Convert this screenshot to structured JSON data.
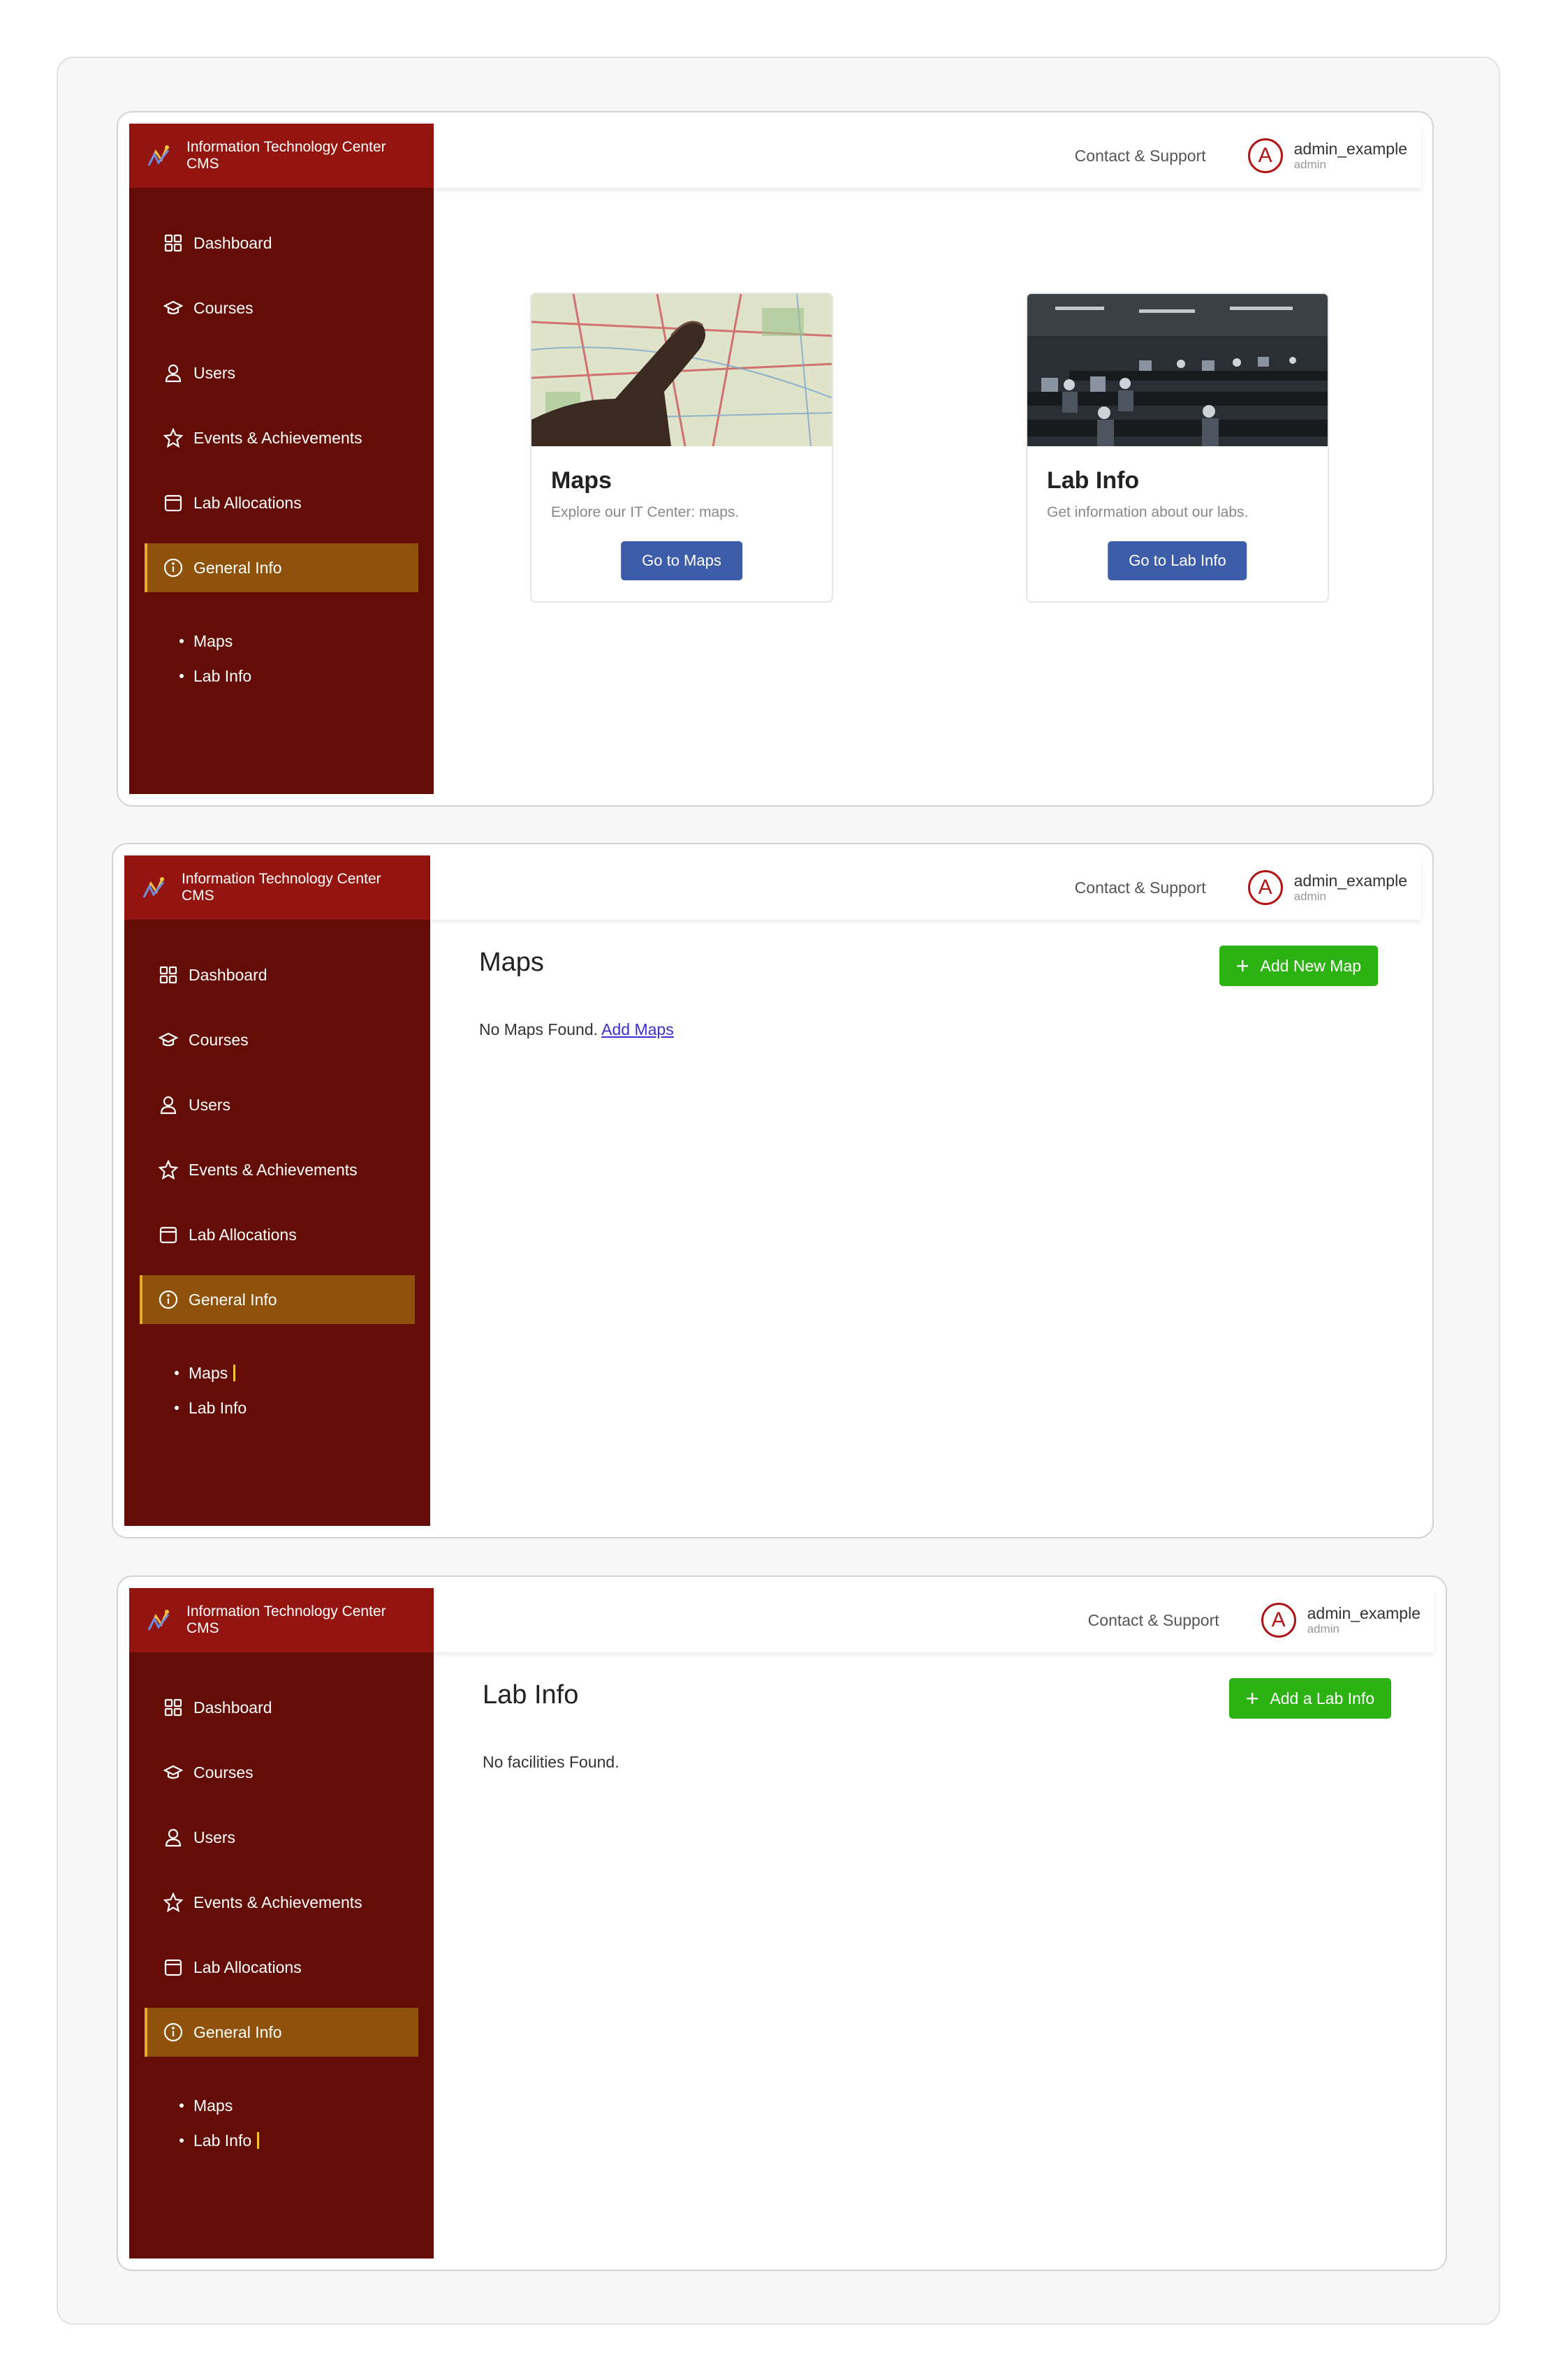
{
  "brand": {
    "line1": "Information Technology Center",
    "line2": "CMS"
  },
  "menu": [
    {
      "label": "Dashboard",
      "icon": "dashboard-icon"
    },
    {
      "label": "Courses",
      "icon": "graduation-cap-icon"
    },
    {
      "label": "Users",
      "icon": "user-icon"
    },
    {
      "label": "Events & Achievements",
      "icon": "star-icon"
    },
    {
      "label": "Lab Allocations",
      "icon": "calendar-icon"
    },
    {
      "label": "General Info",
      "icon": "info-icon"
    }
  ],
  "submenu": [
    {
      "label": "Maps"
    },
    {
      "label": "Lab Info"
    }
  ],
  "header": {
    "contact": "Contact & Support",
    "avatar_letter": "A",
    "username": "admin_example",
    "role": "admin"
  },
  "overview": {
    "cards": [
      {
        "title": "Maps",
        "text": "Explore our IT Center: maps.",
        "button": "Go to Maps"
      },
      {
        "title": "Lab Info",
        "text": "Get information about our labs.",
        "button": "Go to Lab Info"
      }
    ]
  },
  "maps_page": {
    "title": "Maps",
    "add_button": "Add New Map",
    "empty_text": "No Maps Found.",
    "empty_link": "Add Maps"
  },
  "lab_page": {
    "title": "Lab Info",
    "add_button": "Add a Lab Info",
    "empty_text": "No facilities Found."
  },
  "colors": {
    "sidebar": "#640d06",
    "brand": "#941510",
    "active": "#8e520a",
    "primary_btn": "#3d5da8",
    "success_btn": "#2cb313"
  }
}
